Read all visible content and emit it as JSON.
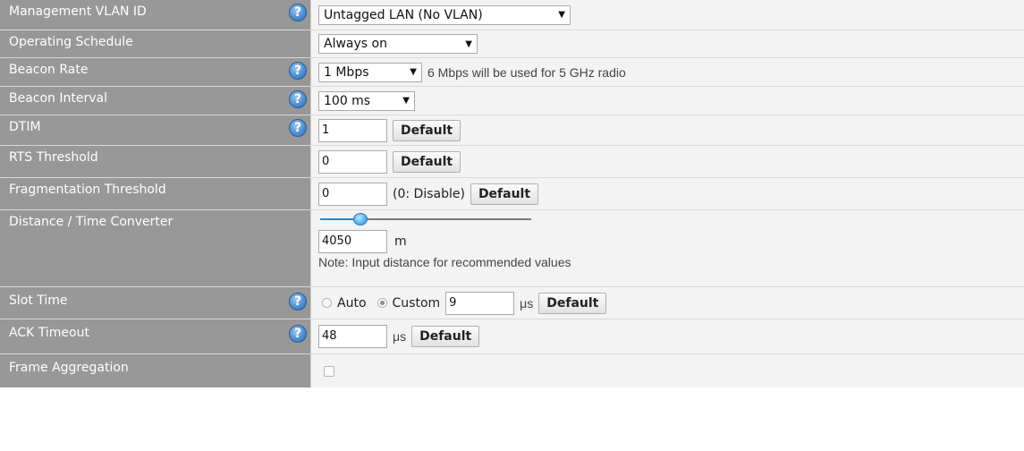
{
  "rows": {
    "management_vlan": {
      "label": "Management VLAN ID",
      "select": "Untagged LAN (No VLAN)"
    },
    "operating_schedule": {
      "label": "Operating Schedule",
      "select": "Always on"
    },
    "beacon_rate": {
      "label": "Beacon Rate",
      "select": "1 Mbps",
      "note": "6 Mbps will be used for 5 GHz radio"
    },
    "beacon_interval": {
      "label": "Beacon Interval",
      "select": "100 ms"
    },
    "dtim": {
      "label": "DTIM",
      "value": "1",
      "button": "Default"
    },
    "rts_threshold": {
      "label": "RTS Threshold",
      "value": "0",
      "button": "Default"
    },
    "fragmentation_threshold": {
      "label": "Fragmentation Threshold",
      "value": "0",
      "hint": "(0: Disable)",
      "button": "Default"
    },
    "distance_time": {
      "label": "Distance / Time Converter",
      "value": "4050",
      "unit": "m",
      "note": "Note: Input distance for recommended values",
      "slider_fraction": 0.17
    },
    "slot_time": {
      "label": "Slot Time",
      "option_auto": "Auto",
      "option_custom": "Custom",
      "selected": "Custom",
      "value": "9",
      "unit": "μs",
      "button": "Default"
    },
    "ack_timeout": {
      "label": "ACK Timeout",
      "value": "48",
      "unit": "μs",
      "button": "Default"
    },
    "frame_aggregation": {
      "label": "Frame Aggregation",
      "checked": false
    }
  },
  "help_glyph": "?",
  "select_arrow": "▼",
  "icons": {
    "help": "help-question-icon",
    "dropdown": "dropdown-arrow-icon"
  },
  "colors": {
    "label_bg": "#989898",
    "value_bg": "#f3f3f3",
    "help_blue": "#4f8fd0",
    "slider_blue": "#2f86c8"
  }
}
